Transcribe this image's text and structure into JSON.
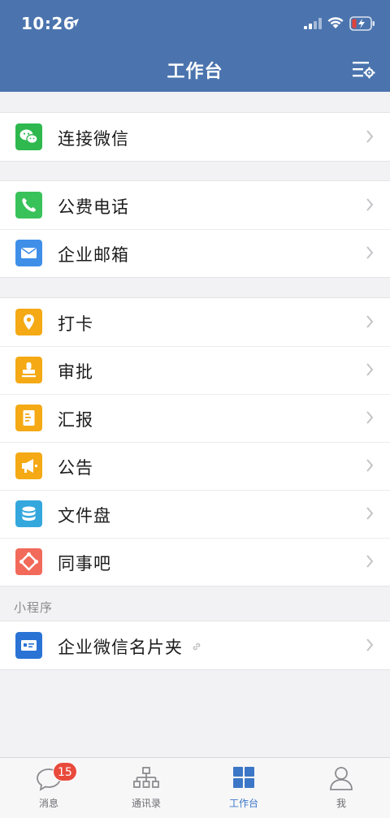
{
  "status_bar": {
    "time": "10:26"
  },
  "header": {
    "title": "工作台"
  },
  "groups": [
    {
      "items": [
        {
          "label": "连接微信",
          "icon": "wechat-icon",
          "color": "#2eb84e"
        }
      ]
    },
    {
      "items": [
        {
          "label": "公费电话",
          "icon": "phone-icon",
          "color": "#39c25a"
        },
        {
          "label": "企业邮箱",
          "icon": "mail-icon",
          "color": "#3f8fe8"
        }
      ]
    },
    {
      "items": [
        {
          "label": "打卡",
          "icon": "location-pin-icon",
          "color": "#f4a915"
        },
        {
          "label": "审批",
          "icon": "stamp-icon",
          "color": "#f4a915"
        },
        {
          "label": "汇报",
          "icon": "report-icon",
          "color": "#f4a915"
        },
        {
          "label": "公告",
          "icon": "megaphone-icon",
          "color": "#f4a915"
        },
        {
          "label": "文件盘",
          "icon": "database-icon",
          "color": "#34a7dd"
        },
        {
          "label": "同事吧",
          "icon": "colleague-icon",
          "color": "#f26a5a"
        }
      ]
    }
  ],
  "mini_programs": {
    "section_label": "小程序",
    "items": [
      {
        "label": "企业微信名片夹",
        "icon": "card-holder-icon",
        "color": "#2a73d5"
      }
    ]
  },
  "tab_bar": {
    "tabs": [
      {
        "label": "消息",
        "badge": "15"
      },
      {
        "label": "通讯录"
      },
      {
        "label": "工作台",
        "active": true
      },
      {
        "label": "我"
      }
    ]
  },
  "colors": {
    "header": "#4b74ae",
    "active_tab": "#3c77c7",
    "badge": "#e84a3c"
  }
}
